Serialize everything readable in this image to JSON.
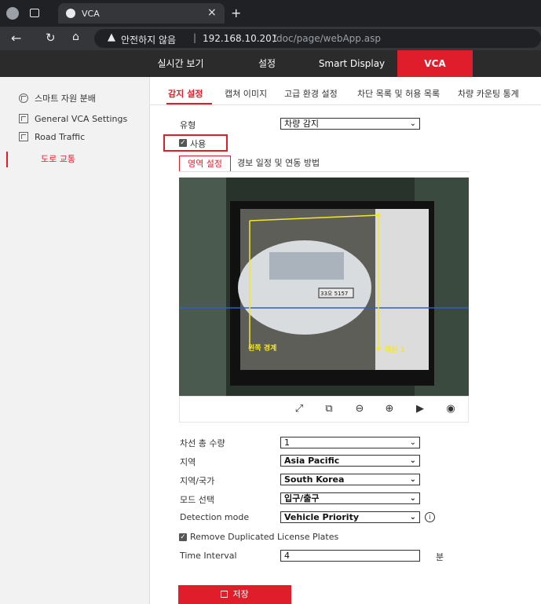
{
  "browser": {
    "tab_title": "VCA",
    "new_tab": "+",
    "tab_close": "×",
    "security_label": "안전하지 않음",
    "url_separator": "|",
    "url_host": "192.168.10.201",
    "url_path": "/doc/page/webApp.asp"
  },
  "nav": {
    "items": [
      "실시간 보기",
      "설정",
      "Smart Display",
      "VCA"
    ],
    "active": "VCA"
  },
  "sidebar": {
    "items": [
      {
        "label": "스마트 자원 분배",
        "icon": "smart-resource-icon"
      },
      {
        "label": "General VCA Settings",
        "icon": "settings-grid-icon"
      },
      {
        "label": "Road Traffic",
        "icon": "road-traffic-icon"
      },
      {
        "label": "도로 교통"
      }
    ]
  },
  "tabs": [
    "감지 설정",
    "캡쳐 이미지",
    "고급 환경 설정",
    "차단 목록 및 허용 목록",
    "차량 카운팅 통계"
  ],
  "form": {
    "type_label": "유형",
    "type_value": "차량 감지",
    "enable_label": "사용",
    "inner_tabs": [
      "영역 설정",
      "경보 일정 및 연동 방법"
    ],
    "lanes_label": "차선 총 수량",
    "lanes_value": "1",
    "region_label": "지역",
    "region_value": "Asia Pacific",
    "country_label": "지역/국가",
    "country_value": "South Korea",
    "mode_label": "모드 선택",
    "mode_value": "입구/출구",
    "detection_label": "Detection mode",
    "detection_value": "Vehicle Priority",
    "remove_dup_label": "Remove Duplicated License Plates",
    "interval_label": "Time Interval",
    "interval_value": "4",
    "interval_unit": "분",
    "save_label": "저장"
  },
  "video": {
    "left_boundary_label": "왼쪽 경계",
    "lane_label": "차선 1",
    "plate_text": "33오 5157"
  },
  "colors": {
    "accent": "#e01e2b",
    "lane_line": "#f5e62a",
    "detect_line": "#2f5fbf"
  }
}
